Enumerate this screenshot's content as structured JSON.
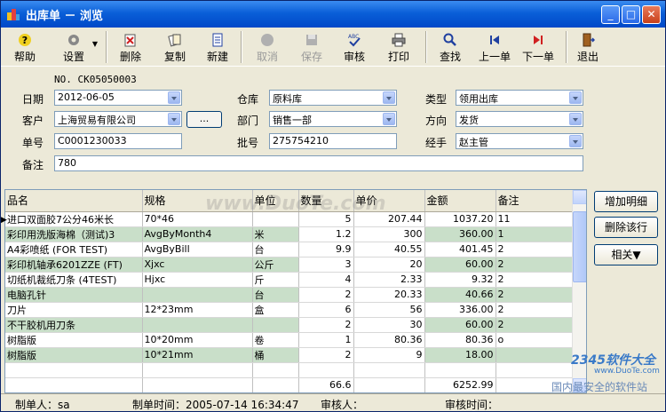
{
  "window": {
    "title": "出库单 － 浏览",
    "controls": {
      "minimize": "_",
      "maximize": "□",
      "close": "✕"
    }
  },
  "toolbar": {
    "help": "帮助",
    "settings": "设置",
    "delete": "删除",
    "copy": "复制",
    "new": "新建",
    "cancel": "取消",
    "save": "保存",
    "approve": "审核",
    "print": "打印",
    "find": "查找",
    "prev": "上一单",
    "next": "下一单",
    "exit": "退出"
  },
  "form": {
    "doc_no": "NO. CK05050003",
    "date_label": "日期",
    "date_value": "2012-06-05",
    "warehouse_label": "仓库",
    "warehouse_value": "原料库",
    "type_label": "类型",
    "type_value": "领用出库",
    "customer_label": "客户",
    "customer_value": "上海贸易有限公司",
    "customer_btn": "...",
    "dept_label": "部门",
    "dept_value": "销售一部",
    "direction_label": "方向",
    "direction_value": "发货",
    "order_label": "单号",
    "order_value": "C0001230033",
    "batch_label": "批号",
    "batch_value": "275754210",
    "handler_label": "经手",
    "handler_value": "赵主管",
    "remark_label": "备注",
    "remark_value": "780"
  },
  "grid": {
    "columns": [
      "品名",
      "规格",
      "单位",
      "数量",
      "单价",
      "金额",
      "备注"
    ],
    "rows": [
      [
        "进口双面胶7公分46米长",
        "70*46",
        "",
        "5",
        "207.44",
        "1037.20",
        "11"
      ],
      [
        "彩印用洗版海棉（测试)3",
        "AvgByMonth4",
        "米",
        "1.2",
        "300",
        "360.00",
        "1"
      ],
      [
        "A4彩喷纸 (FOR TEST)",
        "AvgByBill",
        "台",
        "9.9",
        "40.55",
        "401.45",
        "2"
      ],
      [
        "彩印机轴承6201ZZE (FT)",
        "Xjxc",
        "公斤",
        "3",
        "20",
        "60.00",
        "2"
      ],
      [
        "切纸机裁纸刀条 (4TEST)",
        "Hjxc",
        "斤",
        "4",
        "2.33",
        "9.32",
        "2"
      ],
      [
        "电脑孔针",
        "",
        "台",
        "2",
        "20.33",
        "40.66",
        "2"
      ],
      [
        "刀片",
        "12*23mm",
        "盒",
        "6",
        "56",
        "336.00",
        "2"
      ],
      [
        "不干胶机用刀条",
        "",
        "",
        "2",
        "30",
        "60.00",
        "2"
      ],
      [
        "树脂版",
        "10*20mm",
        "卷",
        "1",
        "80.36",
        "80.36",
        "o"
      ],
      [
        "树脂版",
        "10*21mm",
        "桶",
        "2",
        "9",
        "18.00",
        ""
      ]
    ],
    "total_qty": "66.6",
    "total_amount": "6252.99"
  },
  "side_buttons": {
    "add_detail": "增加明细",
    "delete_row": "删除该行",
    "related": "相关▼"
  },
  "status": {
    "creator": "制单人：sa",
    "created_time": "制单时间：2005-07-14 16:34:47",
    "auditor": "审核人：",
    "audit_time": "审核时间："
  },
  "watermarks": {
    "center": "www.DuoTe.com",
    "brand": "2345软件大全",
    "brand_url": "www.DuoTe.com",
    "slogan": "国内最安全的软件站"
  },
  "colors": {
    "title_bar": "#0a5fd8",
    "row_alt": "#c9dfc9",
    "window_bg": "#ece9d8"
  }
}
